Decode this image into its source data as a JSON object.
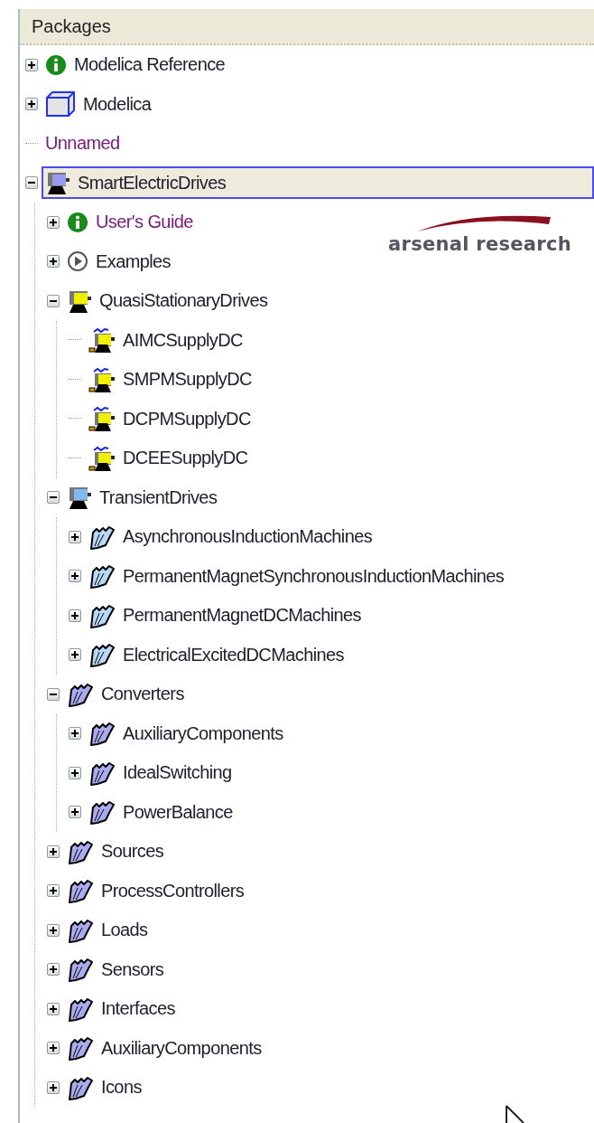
{
  "panel": {
    "title": "Packages"
  },
  "tree": [
    {
      "label": "Modelica Reference",
      "kind": "info",
      "expanded": false,
      "selected": false
    },
    {
      "label": "Modelica",
      "kind": "library",
      "expanded": false,
      "selected": false
    },
    {
      "label": "Unnamed",
      "kind": "plain",
      "selected": false
    },
    {
      "label": "SmartElectricDrives",
      "kind": "drive",
      "color": "#9a9af0",
      "expanded": true,
      "selected": true,
      "children": [
        {
          "label": "User's Guide",
          "kind": "info",
          "expanded": false,
          "selected": false
        },
        {
          "label": "Examples",
          "kind": "examples",
          "expanded": false,
          "selected": false
        },
        {
          "label": "QuasiStationaryDrives",
          "kind": "drive",
          "color": "#f0f000",
          "expanded": true,
          "selected": false,
          "children": [
            {
              "label": "AIMCSupplyDC",
              "kind": "model",
              "selected": false
            },
            {
              "label": "SMPMSupplyDC",
              "kind": "model",
              "selected": false
            },
            {
              "label": "DCPMSupplyDC",
              "kind": "model",
              "selected": false
            },
            {
              "label": "DCEESupplyDC",
              "kind": "model",
              "selected": false
            }
          ]
        },
        {
          "label": "TransientDrives",
          "kind": "drive",
          "color": "#80b8f0",
          "expanded": true,
          "selected": false,
          "children": [
            {
              "label": "AsynchronousInductionMachines",
              "kind": "folder",
              "color": "#b8d8f8",
              "expanded": false,
              "selected": false
            },
            {
              "label": "PermanentMagnetSynchronousInductionMachines",
              "kind": "folder",
              "color": "#b8d8f8",
              "expanded": false,
              "selected": false
            },
            {
              "label": "PermanentMagnetDCMachines",
              "kind": "folder",
              "color": "#b8d8f8",
              "expanded": false,
              "selected": false
            },
            {
              "label": "ElectricalExcitedDCMachines",
              "kind": "folder",
              "color": "#b8d8f8",
              "expanded": false,
              "selected": false
            }
          ]
        },
        {
          "label": "Converters",
          "kind": "folder",
          "color": "#aaaaf0",
          "expanded": true,
          "selected": false,
          "children": [
            {
              "label": "AuxiliaryComponents",
              "kind": "folder",
              "color": "#aaaaf0",
              "expanded": false,
              "selected": false
            },
            {
              "label": "IdealSwitching",
              "kind": "folder",
              "color": "#aaaaf0",
              "expanded": false,
              "selected": false
            },
            {
              "label": "PowerBalance",
              "kind": "folder",
              "color": "#aaaaf0",
              "expanded": false,
              "selected": false
            }
          ]
        },
        {
          "label": "Sources",
          "kind": "folder",
          "color": "#aaaaf0",
          "expanded": false,
          "selected": false
        },
        {
          "label": "ProcessControllers",
          "kind": "folder",
          "color": "#aaaaf0",
          "expanded": false,
          "selected": false
        },
        {
          "label": "Loads",
          "kind": "folder",
          "color": "#aaaaf0",
          "expanded": false,
          "selected": false
        },
        {
          "label": "Sensors",
          "kind": "folder",
          "color": "#aaaaf0",
          "expanded": false,
          "selected": false
        },
        {
          "label": "Interfaces",
          "kind": "folder",
          "color": "#aaaaf0",
          "expanded": false,
          "selected": false
        },
        {
          "label": "AuxiliaryComponents",
          "kind": "folder",
          "color": "#aaaaf0",
          "expanded": false,
          "selected": false
        },
        {
          "label": "Icons",
          "kind": "folder",
          "color": "#aaaaf0",
          "expanded": false,
          "selected": false
        }
      ]
    }
  ],
  "logo": {
    "text": "arsenal research"
  }
}
